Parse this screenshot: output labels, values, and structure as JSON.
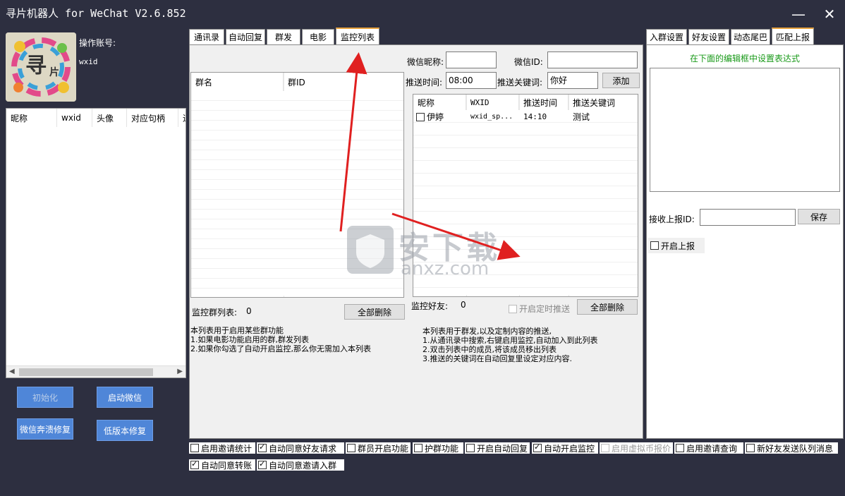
{
  "window": {
    "title": "寻片机器人 for WeChat V2.6.852",
    "minimize": "—",
    "close": "✕"
  },
  "account": {
    "label": "操作账号:",
    "value": "wxid",
    "avatar_text": "寻",
    "avatar_sub": "片"
  },
  "left_table": {
    "headers": [
      "昵称",
      "wxid",
      "头像",
      "对应句柄",
      "进"
    ]
  },
  "left_buttons": {
    "init": "初始化",
    "start_wechat": "启动微信",
    "repair": "微信奔溃修复",
    "low_version": "低版本修复"
  },
  "tabs": [
    "通讯录",
    "自动回复",
    "群发",
    "电影",
    "监控列表"
  ],
  "right_tabs": [
    "入群设置",
    "好友设置",
    "动态尾巴",
    "匹配上报"
  ],
  "monitor": {
    "nickname_label": "微信昵称:",
    "nickname_value": "",
    "wechat_id_label": "微信ID:",
    "wechat_id_value": "",
    "push_time_label": "推送时间:",
    "push_time_value": "08:00",
    "keyword_label": "推送关键词:",
    "keyword_value": "你好",
    "add_button": "添加",
    "group_table_headers": [
      "群名",
      "群ID"
    ],
    "group_count_label": "监控群列表:",
    "group_count": "0",
    "delete_all_groups": "全部删除",
    "friend_table_headers": [
      "昵称",
      "WXID",
      "推送时间",
      "推送关键词"
    ],
    "friend_rows": [
      {
        "checked": false,
        "nickname": "伊婷",
        "wxid": "wxid_sp...",
        "time": "14:10",
        "keyword": "测试"
      }
    ],
    "friend_count_label": "监控好友:",
    "friend_count": "0",
    "timed_push_label": "开启定时推送",
    "delete_all_friends": "全部删除",
    "note_left": "本列表用于启用某些群功能\n1.如果电影功能启用的群,群发列表\n2.如果你勾选了自动开启监控,那么你无需加入本列表",
    "note_right": "本列表用于群发,以及定制内容的推送,\n1.从通讯录中搜索,右键启用监控,自动加入到此列表\n2.双击列表中的成员,将该成员移出列表\n3.推送的关键词在自动回复里设定对应内容."
  },
  "match_report": {
    "hint": "在下面的编辑框中设置表达式",
    "report_id_label": "接收上报ID:",
    "report_id_value": "",
    "save_button": "保存",
    "enable_label": "开启上报"
  },
  "options_row1": [
    {
      "label": "启用邀请统计",
      "checked": false
    },
    {
      "label": "自动同意好友请求",
      "checked": true
    },
    {
      "label": "群员开启功能",
      "checked": false
    },
    {
      "label": "护群功能",
      "checked": false
    },
    {
      "label": "开启自动回复",
      "checked": false
    },
    {
      "label": "自动开启监控",
      "checked": true
    },
    {
      "label": "启用虚拟币报价",
      "checked": false
    },
    {
      "label": "启用邀请查询",
      "checked": false
    },
    {
      "label": "新好友发送队列消息",
      "checked": false
    }
  ],
  "options_row2": [
    {
      "label": "自动同意转账",
      "checked": true
    },
    {
      "label": "自动同意邀请入群",
      "checked": true
    }
  ],
  "watermark": {
    "text": "安下载",
    "sub": "anxz.com"
  },
  "colors": {
    "background": "#2d2f40",
    "button_blue": "#4f86d8",
    "tab_accent": "#e8a23c",
    "hint_green": "#1a9a1a",
    "arrow_red": "#e02020"
  }
}
